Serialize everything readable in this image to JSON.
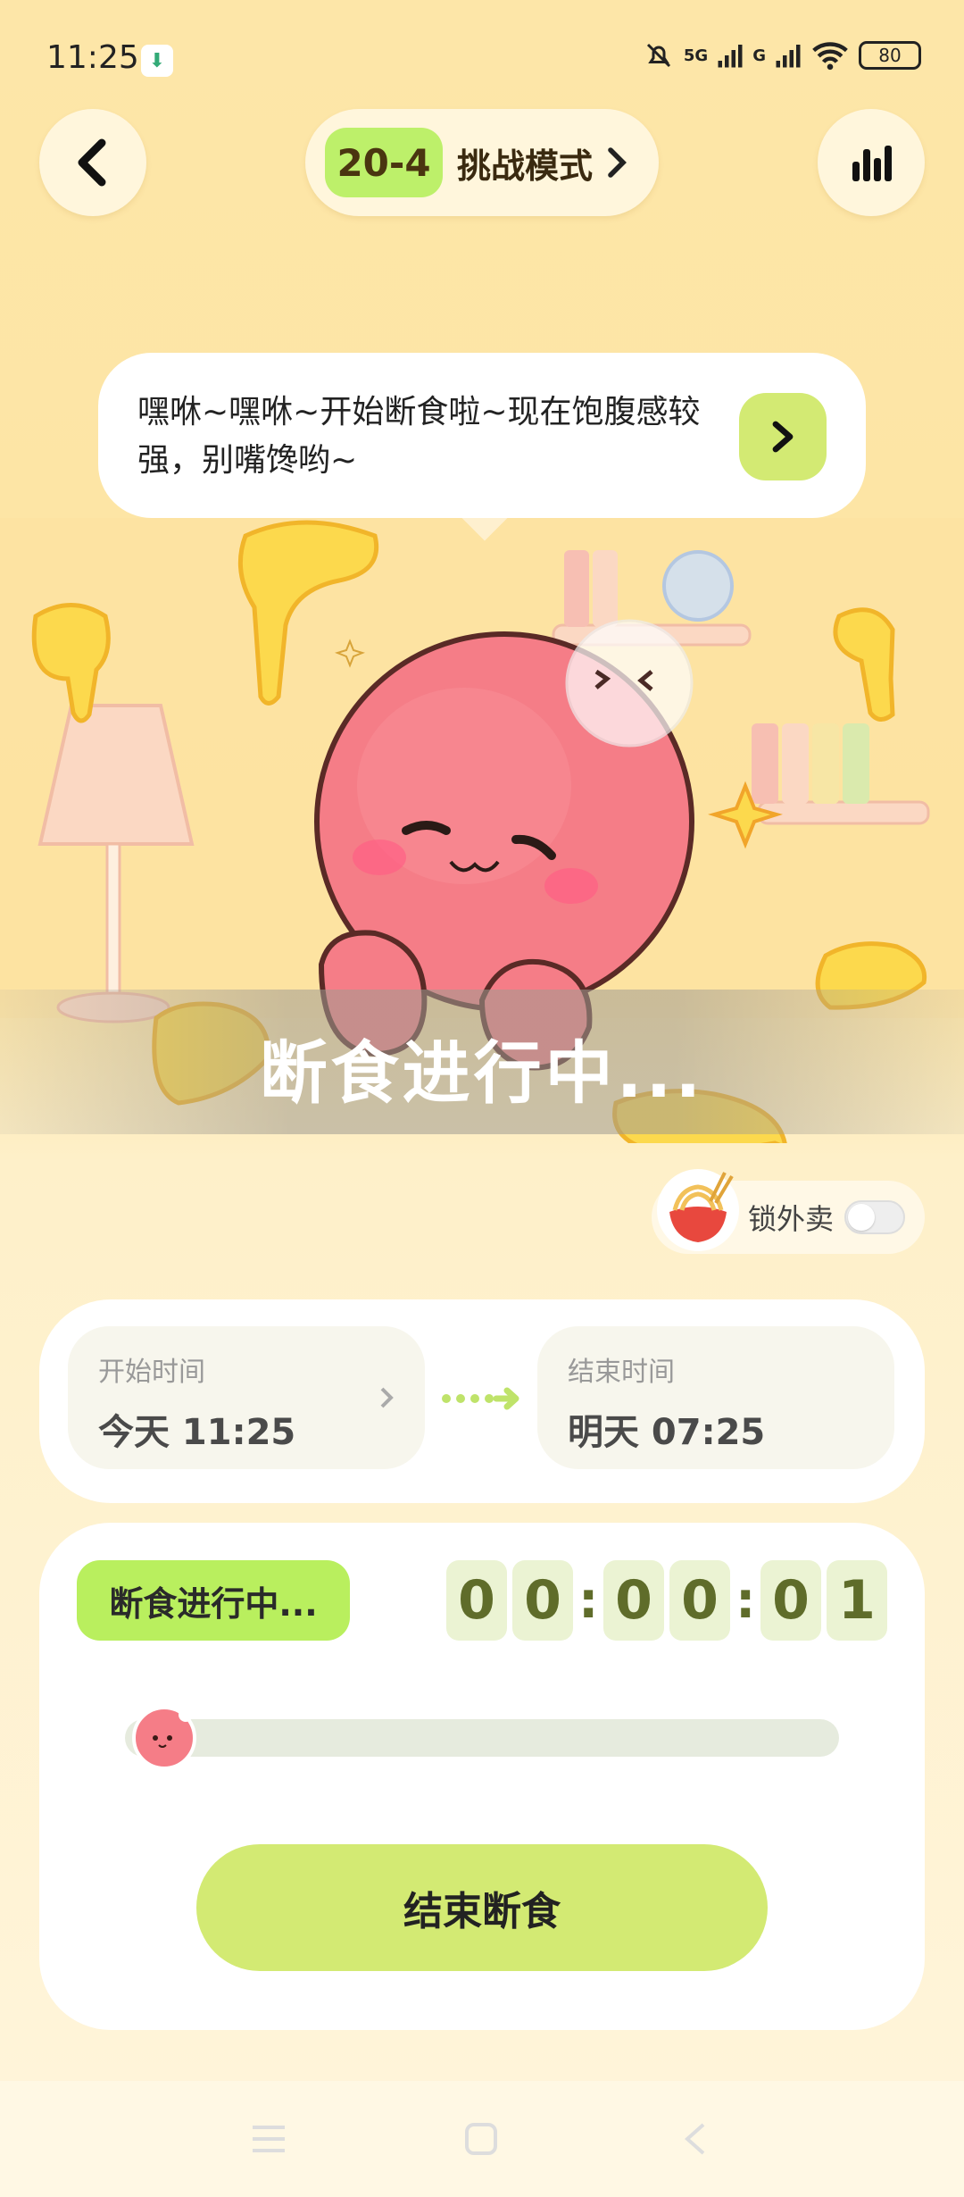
{
  "status_bar": {
    "time": "11:25",
    "signal_1": "5G",
    "signal_2": "G",
    "battery": "80"
  },
  "header": {
    "mode_badge": "20-4",
    "mode_label": "挑战模式"
  },
  "bubble": {
    "text": "嘿咻~嘿咻~开始断食啦~现在饱腹感较强，别嘴馋哟~"
  },
  "scene": {
    "banner_text": "断食进行中..."
  },
  "lock_takeout": {
    "label": "锁外卖",
    "enabled": false
  },
  "time_card": {
    "start_caption": "开始时间",
    "start_value": "今天 11:25",
    "end_caption": "结束时间",
    "end_value": "明天 07:25"
  },
  "timer": {
    "status": "断食进行中...",
    "digits": [
      "0",
      "0",
      "0",
      "0",
      "0",
      "1"
    ],
    "progress": 0.0,
    "end_button": "结束断食"
  },
  "colors": {
    "accent_green": "#d3ea73",
    "badge_green": "#b9ef5e",
    "background": "#fde6a8",
    "character_pink": "#f27a84"
  }
}
